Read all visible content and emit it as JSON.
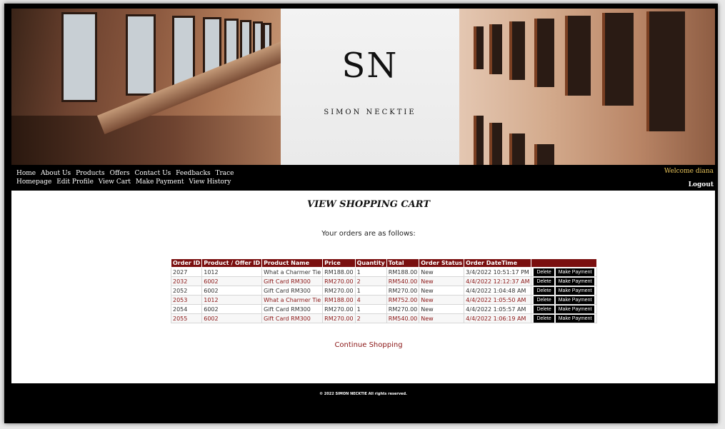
{
  "brand": {
    "logo_mark": "SN",
    "logo_name": "SIMON NECKTIE"
  },
  "nav": {
    "row1": [
      "Home",
      "About Us",
      "Products",
      "Offers",
      "Contact Us",
      "Feedbacks",
      "Trace"
    ],
    "row2": [
      "Homepage",
      "Edit Profile",
      "View Cart",
      "Make Payment",
      "View History"
    ],
    "welcome": "Welcome diana",
    "logout": "Logout"
  },
  "page": {
    "title": "VIEW SHOPPING CART",
    "subtitle": "Your orders are as follows:",
    "continue_label": "Continue Shopping"
  },
  "table": {
    "headers": [
      "Order ID",
      "Product / Offer ID",
      "Product Name",
      "Price",
      "Quantity",
      "Total",
      "Order Status",
      "Order DateTime",
      ""
    ],
    "delete_label": "Delete",
    "pay_label": "Make Payment",
    "rows": [
      [
        "2027",
        "1012",
        "What a Charmer Tie",
        "RM188.00",
        "1",
        "RM188.00",
        "New",
        "3/4/2022 10:51:17 PM"
      ],
      [
        "2032",
        "6002",
        "Gift Card RM300",
        "RM270.00",
        "2",
        "RM540.00",
        "New",
        "4/4/2022 12:12:37 AM"
      ],
      [
        "2052",
        "6002",
        "Gift Card RM300",
        "RM270.00",
        "1",
        "RM270.00",
        "New",
        "4/4/2022 1:04:48 AM"
      ],
      [
        "2053",
        "1012",
        "What a Charmer Tie",
        "RM188.00",
        "4",
        "RM752.00",
        "New",
        "4/4/2022 1:05:50 AM"
      ],
      [
        "2054",
        "6002",
        "Gift Card RM300",
        "RM270.00",
        "1",
        "RM270.00",
        "New",
        "4/4/2022 1:05:57 AM"
      ],
      [
        "2055",
        "6002",
        "Gift Card RM300",
        "RM270.00",
        "2",
        "RM540.00",
        "New",
        "4/4/2022 1:06:19 AM"
      ]
    ]
  },
  "footer": {
    "text": "© 2022 SIMON NECKTIE All rights reserved."
  },
  "colors": {
    "header_row": "#7a0f0f",
    "accent_text": "#8a1414",
    "welcome": "#e8c35a"
  }
}
